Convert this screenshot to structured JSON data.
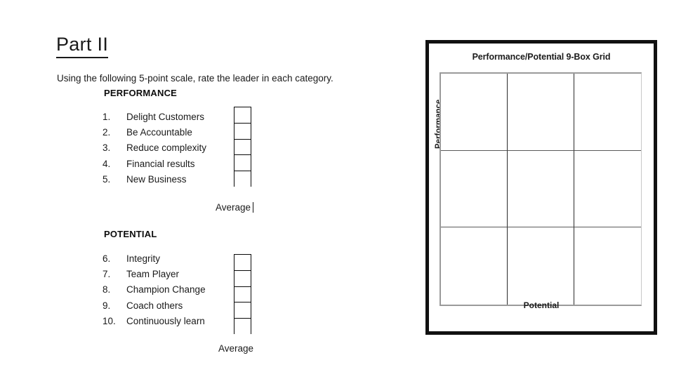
{
  "document": {
    "title": "Part II",
    "instruction": "Using the following 5-point scale, rate the leader in each category."
  },
  "performance_section": {
    "heading": "PERFORMANCE",
    "items": [
      {
        "number": "1.",
        "label": "Delight Customers",
        "score": ""
      },
      {
        "number": "2.",
        "label": "Be Accountable",
        "score": ""
      },
      {
        "number": "3.",
        "label": "Reduce complexity",
        "score": ""
      },
      {
        "number": "4.",
        "label": "Financial results",
        "score": ""
      },
      {
        "number": "5.",
        "label": "New Business",
        "score": ""
      }
    ],
    "average_label": "Average",
    "average_value": "",
    "caret_visible": true
  },
  "potential_section": {
    "heading": "POTENTIAL",
    "items": [
      {
        "number": "6.",
        "label": "Integrity",
        "score": ""
      },
      {
        "number": "7.",
        "label": "Team Player",
        "score": ""
      },
      {
        "number": "8.",
        "label": "Champion Change",
        "score": ""
      },
      {
        "number": "9.",
        "label": "Coach others",
        "score": ""
      },
      {
        "number": "10.",
        "label": "Continuously learn",
        "score": ""
      }
    ],
    "average_label": "Average",
    "average_value": "",
    "caret_visible": false
  },
  "nine_box_grid": {
    "title": "Performance/Potential 9-Box Grid",
    "y_axis_label": "Performance",
    "x_axis_label": "Potential",
    "rows": 3,
    "columns": 3,
    "cells": [
      {
        "row": 1,
        "column": 1,
        "content": ""
      },
      {
        "row": 1,
        "column": 2,
        "content": ""
      },
      {
        "row": 1,
        "column": 3,
        "content": ""
      },
      {
        "row": 2,
        "column": 1,
        "content": ""
      },
      {
        "row": 2,
        "column": 2,
        "content": ""
      },
      {
        "row": 2,
        "column": 3,
        "content": ""
      },
      {
        "row": 3,
        "column": 1,
        "content": ""
      },
      {
        "row": 3,
        "column": 2,
        "content": ""
      },
      {
        "row": 3,
        "column": 3,
        "content": ""
      }
    ]
  },
  "colors": {
    "page_background": "#ffffff",
    "text": "#1a1a1a",
    "frame_border": "#111111",
    "grid_line": "#2b2b2b",
    "grid_outer_line": "#9a9a9a",
    "score_box_border": "#0a0a0a"
  }
}
